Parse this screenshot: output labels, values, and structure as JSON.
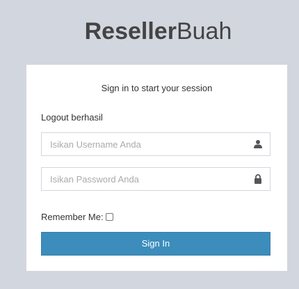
{
  "logo": {
    "bold": "Reseller",
    "light": "Buah"
  },
  "login": {
    "message": "Sign in to start your session",
    "status": "Logout berhasil",
    "username_placeholder": "Isikan Username Anda",
    "password_placeholder": "Isikan Password Anda",
    "remember_label": "Remember Me:",
    "remember_checked": false,
    "signin_label": "Sign In"
  },
  "icons": {
    "username": "user-icon",
    "password": "lock-icon"
  },
  "colors": {
    "background": "#d2d6de",
    "button": "#3c8dbc",
    "box": "#ffffff"
  }
}
